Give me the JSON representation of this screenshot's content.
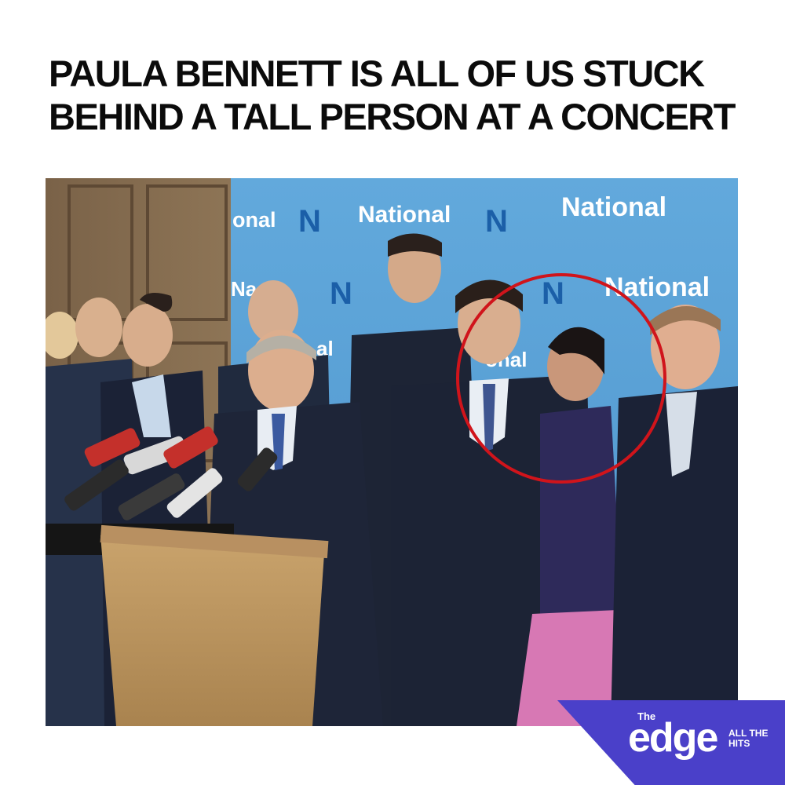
{
  "headline": {
    "line1": "PAULA BENNETT IS ALL OF US STUCK",
    "line2": "BEHIND A TALL PERSON AT A CONCERT"
  },
  "backdrop": {
    "word": "National",
    "partial_left": "onal",
    "partial_mid": "Na   al",
    "partial_low_left": "al",
    "partial_low_right": "onal",
    "logo_letter": "N",
    "logo_color": "#1b5fa8",
    "backdrop_color": "#5fa8db"
  },
  "photo": {
    "highlight_circle_color": "#d0141b"
  },
  "brand": {
    "small": "The",
    "word": "edge",
    "tagline": "ALL THE HITS",
    "color": "#4a40c9"
  }
}
